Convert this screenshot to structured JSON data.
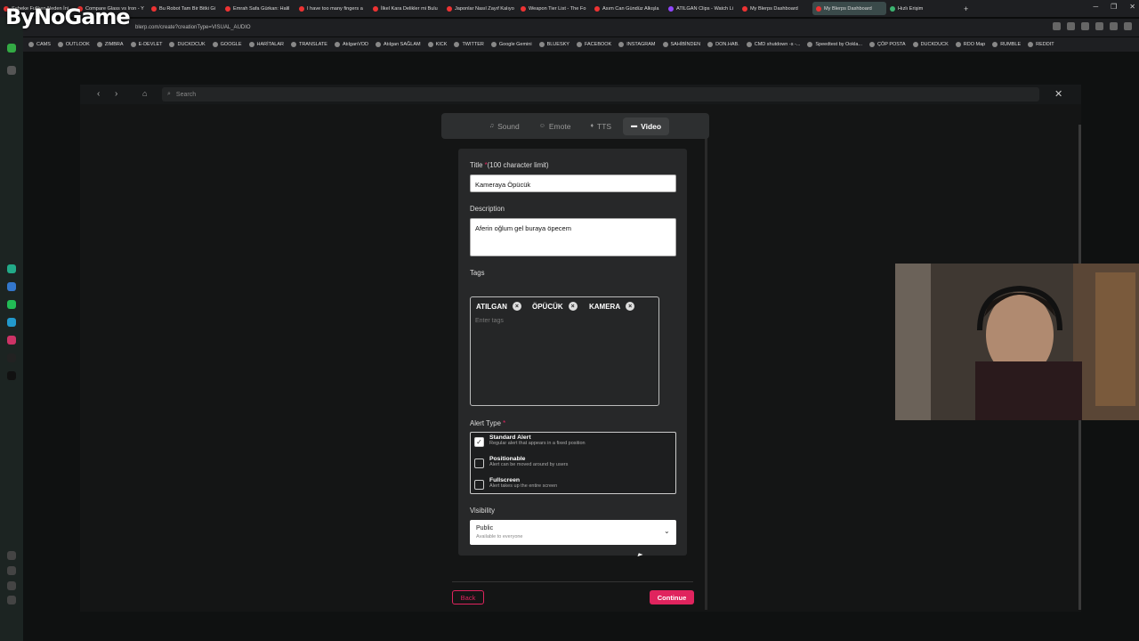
{
  "watermark": "ByNoGame",
  "browser": {
    "tabs": [
      {
        "label": "Şebeke Fullken Neden İni...",
        "kind": "yt"
      },
      {
        "label": "Compare Glass vs Iron - Y",
        "kind": "yt"
      },
      {
        "label": "Bu Robot Tam Bir Bitki Gi",
        "kind": "yt"
      },
      {
        "label": "Emrah Safa Gürkan: Halil",
        "kind": "yt"
      },
      {
        "label": "I have too many fingers a",
        "kind": "yt"
      },
      {
        "label": "İlkel Kara Delikler mi Bulu",
        "kind": "yt"
      },
      {
        "label": "Japonlar Nasıl Zayıf Kalıyo",
        "kind": "yt"
      },
      {
        "label": "Weapon Tier List - The Fo",
        "kind": "yt"
      },
      {
        "label": "Asım Can Gündüz Alkışla",
        "kind": "yt"
      },
      {
        "label": "ATILGAN Clips - Watch Li",
        "kind": "twitch"
      },
      {
        "label": "My Blerps Dashboard",
        "kind": "yt"
      },
      {
        "label": "My Blerps Dashboard",
        "kind": "active"
      },
      {
        "label": "Hızlı Erişim",
        "kind": "other"
      }
    ],
    "url": "blerp.com/create?creationType=VISUAL_AUDIO",
    "bookmarks": [
      "CAMS",
      "OUTLOOK",
      "ZIMBRA",
      "E-DEVLET",
      "DUCKDCUK",
      "GOOGLE",
      "HARİTALAR",
      "TRANSLATE",
      "AtılganVOD",
      "Atılgan SAĞLAM",
      "KICK",
      "TWITTER",
      "Google Gemini",
      "BLUESKY",
      "FACEBOOK",
      "INSTAGRAM",
      "SAHİBİNDEN",
      "DON.HAB.",
      "CMD shutdown -s -...",
      "Speedtest by Ookla...",
      "ÇÖP POSTA",
      "DUCKDUCK",
      "RDO Map",
      "RUMBLE",
      "REDDIT"
    ]
  },
  "modal": {
    "search_placeholder": "Search",
    "type_tabs": [
      {
        "label": "Sound",
        "icon": "♫"
      },
      {
        "label": "Emote",
        "icon": "☺"
      },
      {
        "label": "TTS",
        "icon": "♦"
      },
      {
        "label": "Video",
        "icon": "▬"
      }
    ],
    "title_label": "Title",
    "title_hint": "(100 character limit)",
    "title_value": "Kameraya Öpücük",
    "description_label": "Description",
    "description_value": "Aferin oğlum gel buraya öpecem",
    "tags_label": "Tags",
    "tags": [
      "ATILGAN",
      "ÖPÜCÜK",
      "KAMERA"
    ],
    "tags_placeholder": "Enter tags",
    "alert_type_label": "Alert Type",
    "alert_options": [
      {
        "title": "Standard Alert",
        "desc": "Regular alert that appears in a fixed position",
        "checked": true
      },
      {
        "title": "Positionable",
        "desc": "Alert can be moved around by users",
        "checked": false
      },
      {
        "title": "Fullscreen",
        "desc": "Alert takes up the entire screen",
        "checked": false
      }
    ],
    "visibility_label": "Visibility",
    "visibility_value": "Public",
    "visibility_sub": "Available to everyone",
    "back_label": "Back",
    "continue_label": "Continue"
  },
  "colors": {
    "accent": "#e0245e"
  }
}
